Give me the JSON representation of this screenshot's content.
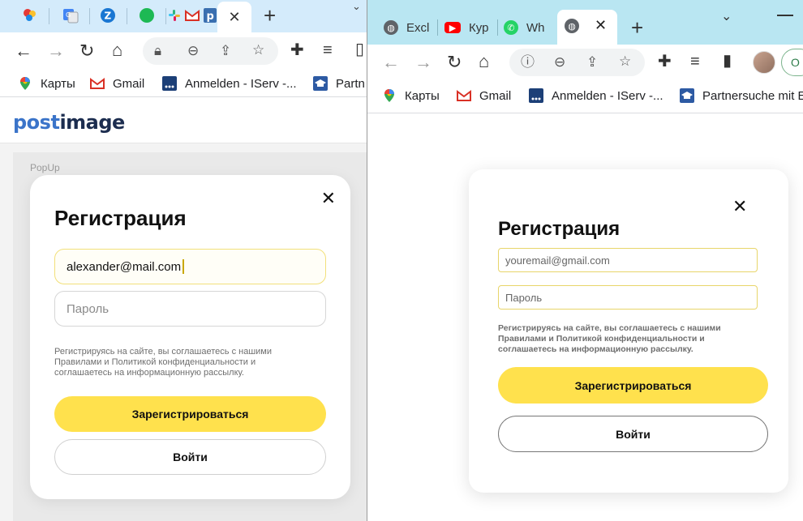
{
  "left_window": {
    "tabs": {
      "active_close": "✕",
      "new_tab": "+"
    },
    "bookmarks": [
      {
        "label": "Карты"
      },
      {
        "label": "Gmail"
      },
      {
        "label": "Anmelden - IServ -..."
      },
      {
        "label": "Partn"
      }
    ],
    "site": {
      "logo": "postimage",
      "frame_label": "PopUp"
    },
    "modal": {
      "close": "✕",
      "title": "Регистрация",
      "email_value": "alexander@mail.com",
      "password_placeholder": "Пароль",
      "consent": "Регистрируясь на сайте, вы соглашаетесь с нашими Правилами и Политикой конфиденциальности и соглашаетесь на информационную рассылку.",
      "register_button": "Зарегистрироваться",
      "login_button": "Войти"
    }
  },
  "right_window": {
    "tabs": [
      {
        "label": "Excl"
      },
      {
        "label": "Кур"
      },
      {
        "label": "Wh"
      }
    ],
    "active_close": "✕",
    "new_tab": "+",
    "profile_initial": "O",
    "bookmarks": [
      {
        "label": "Карты"
      },
      {
        "label": "Gmail"
      },
      {
        "label": "Anmelden - IServ -..."
      },
      {
        "label": "Partnersuche mit E"
      }
    ],
    "modal": {
      "close": "✕",
      "title": "Регистрация",
      "email_placeholder": "youremail@gmail.com",
      "password_placeholder": "Пароль",
      "consent": "Регистрируясь на сайте, вы соглашаетесь с нашими Правилами и Политикой конфиденциальности и соглашаетесь на информационную рассылку.",
      "register_button": "Зарегистрироваться",
      "login_button": "Войти"
    }
  },
  "colors": {
    "accent_yellow": "#ffe14d",
    "left_tabstrip": "#d4ebfb",
    "right_tabstrip": "#b9e6f2",
    "logo_blue": "#3b74c9",
    "logo_dark": "#1c2d4f"
  }
}
